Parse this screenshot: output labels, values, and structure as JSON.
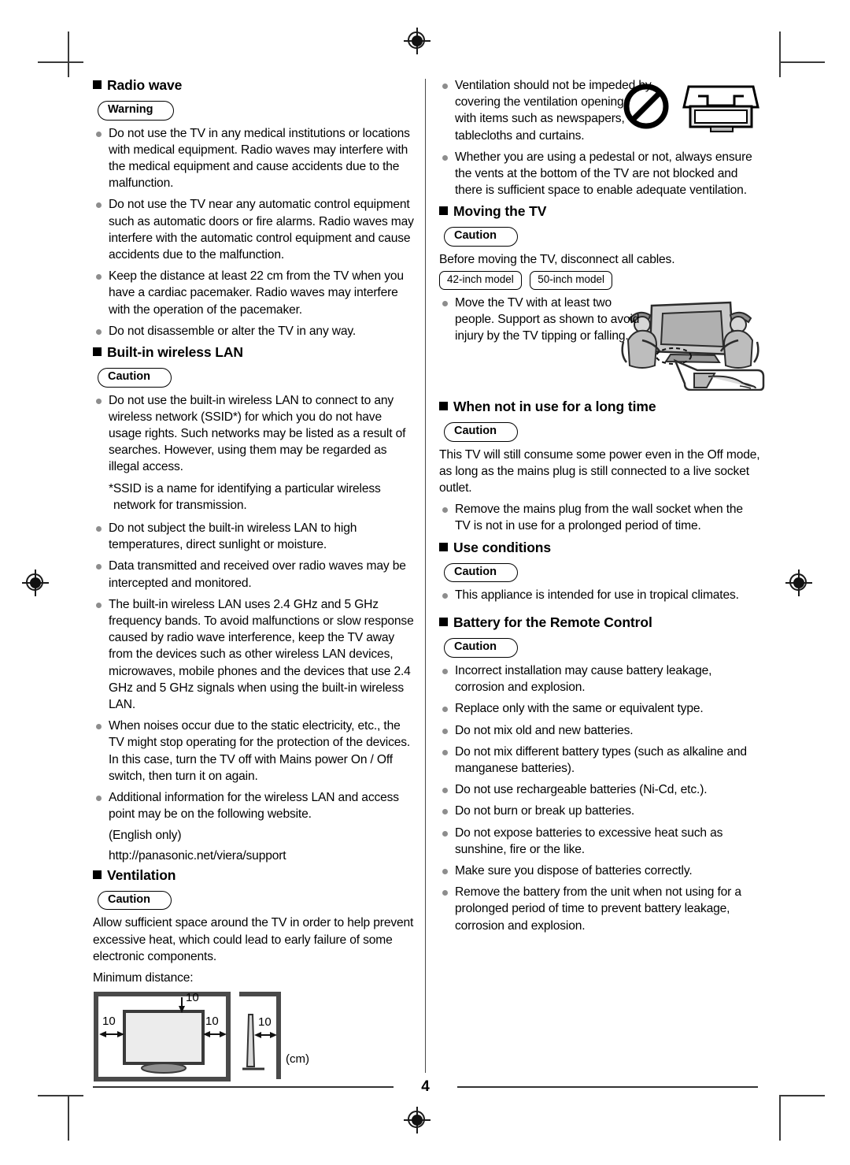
{
  "page": {
    "number": "4",
    "cm_unit_label": "(cm)"
  },
  "left_column": {
    "sections": [
      {
        "id": "radio-wave",
        "heading": "Radio wave",
        "badge": "Warning",
        "bullets": [
          "Do not use the TV in any medical institutions or locations with medical equipment. Radio waves may interfere with the medical equipment and cause accidents due to the malfunction.",
          "Do not use the TV near any automatic control equipment such as automatic doors or fire alarms. Radio waves may interfere with the automatic control equipment and cause accidents due to the malfunction.",
          "Keep the distance at least 22 cm from the TV when you have a cardiac pacemaker. Radio waves may interfere with the operation of the pacemaker.",
          "Do not disassemble or alter the TV in any way."
        ]
      },
      {
        "id": "built-in-wireless-lan",
        "heading": "Built-in wireless LAN",
        "badge": "Caution",
        "bullets_group_1": [
          "Do not use the built-in wireless LAN to connect to any wireless network (SSID*) for which you do not have usage rights. Such networks may be listed as a result of searches. However, using them may be regarded as illegal access."
        ],
        "footnote": "*SSID is a name for identifying a particular wireless network for transmission.",
        "bullets_group_2": [
          "Do not subject the built-in wireless LAN to high temperatures, direct sunlight or moisture.",
          "Data transmitted and received over radio waves may be intercepted and monitored.",
          "The built-in wireless LAN uses 2.4 GHz and 5 GHz frequency bands. To avoid malfunctions or slow response caused by radio wave interference, keep the TV away from the devices such as other wireless LAN devices, microwaves, mobile phones and the devices that use 2.4 GHz and 5 GHz signals when using the built-in wireless LAN.",
          "When noises occur due to the static electricity, etc., the TV might stop operating for the protection of the devices. In this case, turn the TV off with Mains power On / Off switch, then turn it on again.",
          "Additional information for the wireless LAN and access point may be on the following website."
        ],
        "language_note": "(English only)",
        "website": "http://panasonic.net/viera/support"
      },
      {
        "id": "ventilation",
        "heading": "Ventilation",
        "badge": "Caution",
        "paragraph": "Allow sufficient space around the TV in order to help prevent excessive heat, which could lead to early failure of some electronic components.",
        "min_distance_label": "Minimum distance:",
        "diagram": {
          "top_value": "10",
          "left_value": "10",
          "right_value": "10",
          "side_value": "10",
          "unit": "(cm)"
        }
      }
    ]
  },
  "right_column": {
    "ventilation_continued": {
      "bullets": [
        "Ventilation should not be impeded by covering the ventilation openings with items such as newspapers, tablecloths and curtains.",
        "Whether you are using a pedestal or not, always ensure the vents at the bottom of the TV are not blocked and there is sufficient space to enable adequate ventilation."
      ],
      "icons": [
        "prohibition-icon",
        "tv-covered-by-cloth-icon"
      ]
    },
    "sections": [
      {
        "id": "moving-the-tv",
        "heading": "Moving the TV",
        "badge": "Caution",
        "paragraph": "Before moving the TV, disconnect all cables.",
        "model_badges": [
          "42-inch model",
          "50-inch model"
        ],
        "bullets": [
          "Move the TV with at least two people. Support as shown to avoid injury by the TV tipping or falling."
        ],
        "figure": "two-people-carrying-tv-illustration"
      },
      {
        "id": "when-not-in-use-for-a-long-time",
        "heading": "When not in use for a long time",
        "badge": "Caution",
        "paragraph": "This TV will still consume some power even in the Off mode, as long as the mains plug is still connected to a live socket outlet.",
        "bullets": [
          "Remove the mains plug from the wall socket when the TV is not in use for a prolonged period of time."
        ]
      },
      {
        "id": "use-conditions",
        "heading": "Use conditions",
        "badge": "Caution",
        "bullets": [
          "This appliance is intended for use in tropical climates."
        ]
      },
      {
        "id": "battery-for-the-remote-control",
        "heading": "Battery for the Remote Control",
        "badge": "Caution",
        "bullets": [
          "Incorrect installation may cause battery leakage, corrosion and explosion.",
          "Replace only with the same or equivalent type.",
          "Do not mix old and new batteries.",
          "Do not mix different battery types (such as alkaline and manganese batteries).",
          "Do not use rechargeable batteries (Ni-Cd, etc.).",
          "Do not burn or break up batteries.",
          "Do not expose batteries to excessive heat such as sunshine, fire or the like.",
          "Make sure you dispose of batteries correctly.",
          "Remove the battery from the unit when not using for a prolonged period of time to prevent battery leakage, corrosion and explosion."
        ]
      }
    ]
  }
}
